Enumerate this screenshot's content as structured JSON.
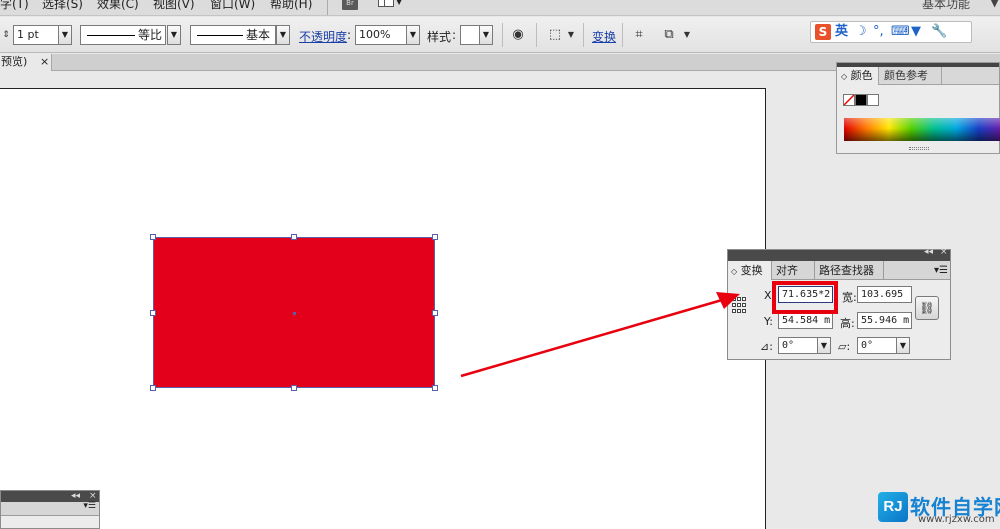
{
  "menubar": {
    "items": [
      "字(T)",
      "选择(S)",
      "效果(C)",
      "视图(V)",
      "窗口(W)",
      "帮助(H)"
    ],
    "bridge_label": "Br",
    "workspace": "基本功能",
    "workspace_arrow": "▼"
  },
  "controlbar": {
    "stroke_weight": "1 pt",
    "profile_label": "等比",
    "brush_label": "基本",
    "opacity_label": "不透明度",
    "opacity_value": "100%",
    "style_label": "样式",
    "transform_link": "变换",
    "icons": [
      "stroke-weight-stepper-icon",
      "recolor-icon",
      "align-options-icon",
      "isolate-icon",
      "transform-options-icon"
    ]
  },
  "ime": {
    "logo": "S",
    "lang": "英",
    "icons": [
      "moon-icon",
      "punctuation-icon",
      "keyboard-icon",
      "skin-icon",
      "wrench-icon"
    ]
  },
  "document_tab": {
    "title": "预览)",
    "close": "×"
  },
  "color_panel": {
    "tabs": [
      "颜色",
      "颜色参考"
    ],
    "colors": {
      "fill": "#000000",
      "none": "#ffffff",
      "accent": "#e2001a"
    }
  },
  "canvas": {
    "object_color": "#e2001a",
    "selection_color": "#5b5ea8"
  },
  "transform_panel": {
    "tabs": [
      "变换",
      "对齐",
      "路径查找器"
    ],
    "x_label": "X:",
    "x_value": "71.635*2",
    "width_label": "宽:",
    "width_value": "103.695",
    "y_label": "Y:",
    "y_value": "54.584 m",
    "height_label": "高:",
    "height_value": "55.946 m",
    "rotate_label": "⊿:",
    "rotate_value": "0°",
    "shear_label": "▱:",
    "shear_value": "0°",
    "collapse": "◂◂",
    "close": "×",
    "menu": "▾☰"
  },
  "bottom_panel": {
    "collapse": "◂◂",
    "close": "×"
  },
  "watermark": {
    "logo": "RJ",
    "title": "软件自学网",
    "url": "www.rjzxw.com"
  }
}
